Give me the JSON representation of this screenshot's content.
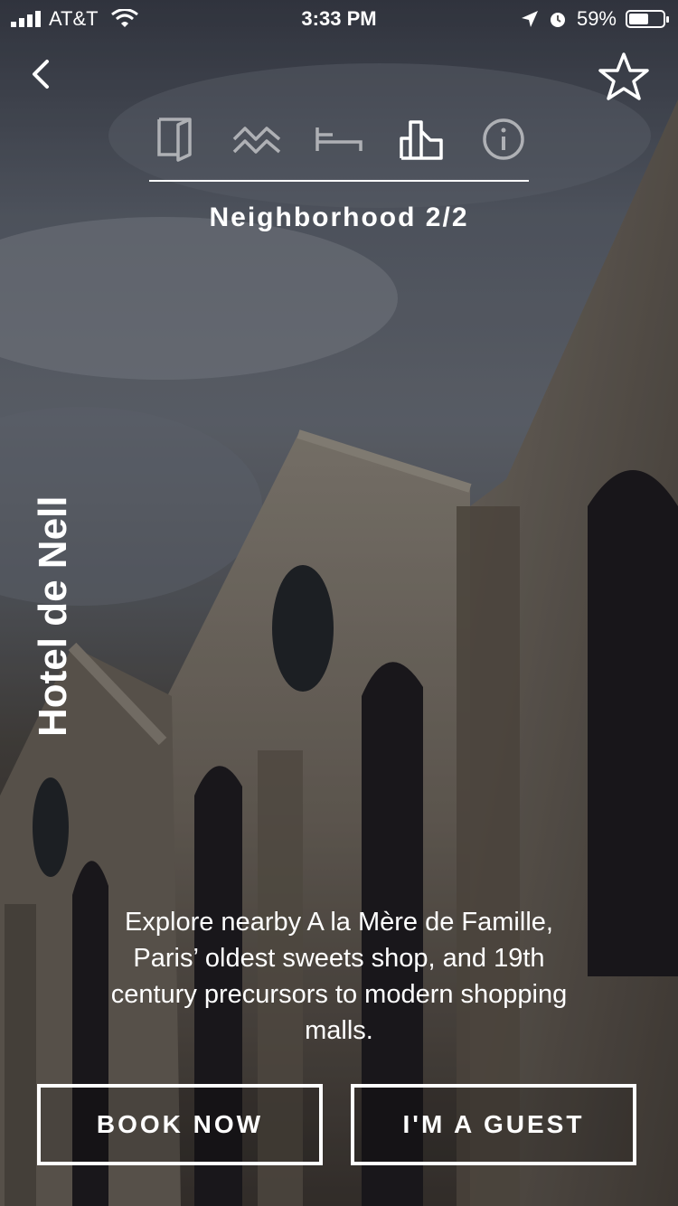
{
  "status_bar": {
    "carrier": "AT&T",
    "time": "3:33 PM",
    "battery": "59%",
    "battery_level": 0.59,
    "icons": [
      "signal-icon",
      "wifi-icon",
      "location-arrow-icon",
      "alarm-icon",
      "battery-icon"
    ]
  },
  "nav": {
    "back_icon": "chevron-left-icon",
    "favorite_icon": "star-outline-icon"
  },
  "tabs": [
    {
      "icon": "door-icon",
      "active": false
    },
    {
      "icon": "waves-icon",
      "active": false
    },
    {
      "icon": "bed-icon",
      "active": false
    },
    {
      "icon": "buildings-icon",
      "active": true
    },
    {
      "icon": "info-icon",
      "active": false
    }
  ],
  "section_title": "Neighborhood 2/2",
  "hotel_name": "Hotel de Nell",
  "description": "Explore nearby A la Mère de Famille, Paris’ oldest sweets shop, and 19th century precursors to modern shopping malls.",
  "buttons": {
    "book": "BOOK NOW",
    "guest": "I'M A GUEST"
  }
}
